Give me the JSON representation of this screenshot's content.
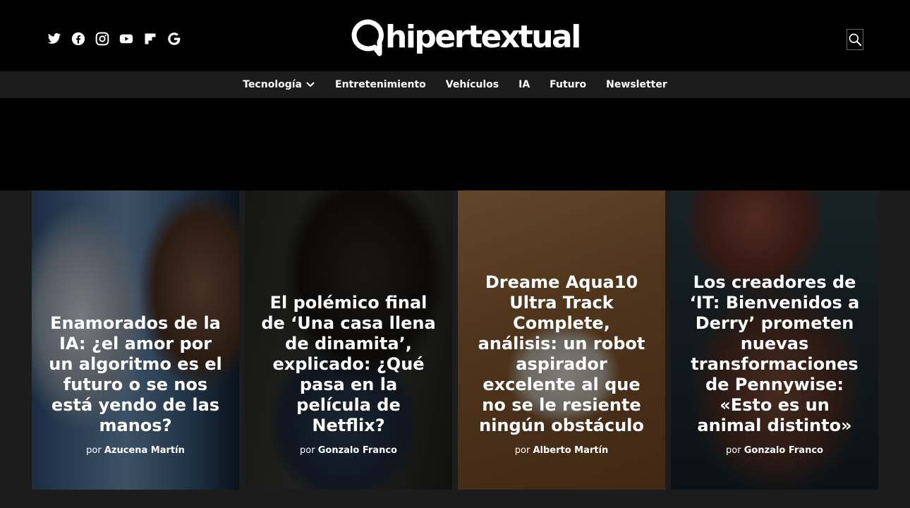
{
  "header": {
    "logo_text": "hipertextual",
    "socials": [
      "twitter-icon",
      "facebook-icon",
      "instagram-icon",
      "youtube-icon",
      "flipboard-icon",
      "google-news-icon"
    ],
    "search_icon": "search-icon"
  },
  "nav": {
    "items": [
      {
        "label": "Tecnología",
        "has_dropdown": true
      },
      {
        "label": "Entretenimiento"
      },
      {
        "label": "Vehículos"
      },
      {
        "label": "IA"
      },
      {
        "label": "Futuro"
      },
      {
        "label": "Newsletter"
      }
    ]
  },
  "cards": [
    {
      "title": "Enamorados de la IA: ¿el amor por un algoritmo es el futuro o se nos está yendo de las manos?",
      "by": "por",
      "author": "Azucena Martín"
    },
    {
      "title": "El polémico final de ‘Una casa llena de dinamita’, explicado: ¿Qué pasa en la película de Netflix?",
      "by": "por",
      "author": "Gonzalo Franco"
    },
    {
      "title": "Dreame Aqua10 Ultra Track Complete, análisis: un robot aspirador excelente al que no se le resiente ningún obstáculo",
      "by": "por",
      "author": "Alberto Martín"
    },
    {
      "title": "Los creadores de ‘IT: Bienvenidos a Derry’ prometen nuevas transformaciones de Pennywise: «Esto es un animal distinto»",
      "by": "por",
      "author": "Gonzalo Franco"
    }
  ],
  "colors": {
    "background": "#000000",
    "nav_bg": "#1c1c1c",
    "text": "#ffffff"
  }
}
